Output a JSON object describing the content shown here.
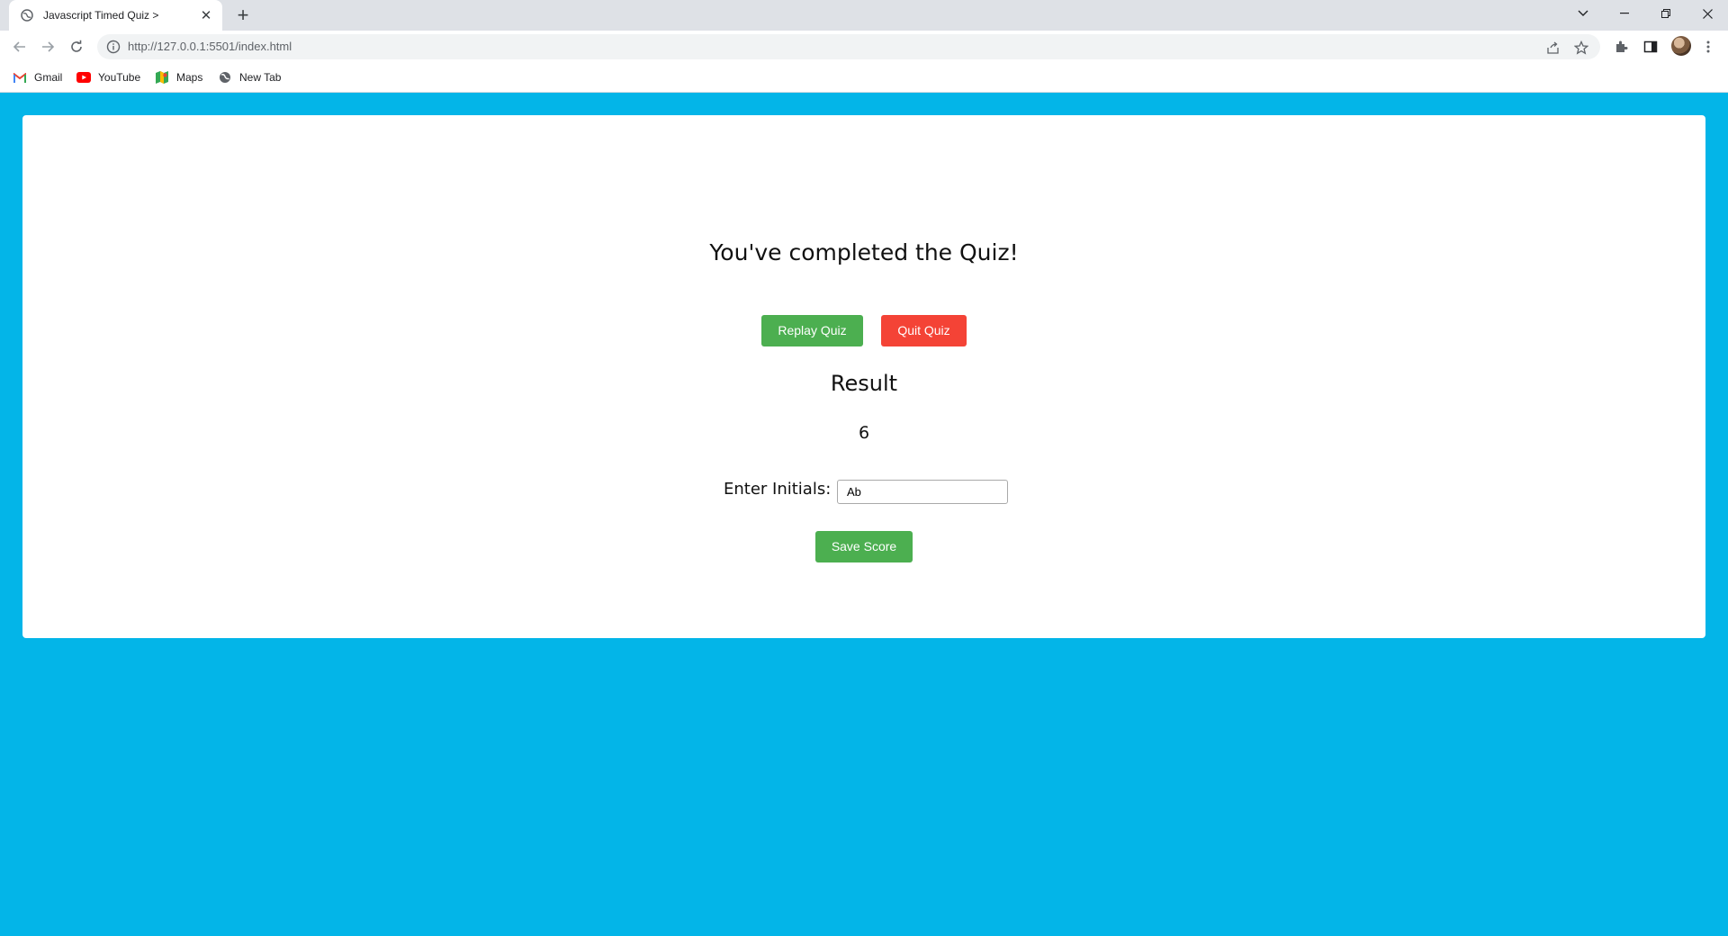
{
  "browser": {
    "tab_title": "Javascript Timed Quiz >",
    "url": "http://127.0.0.1:5501/index.html",
    "bookmarks": [
      {
        "label": "Gmail",
        "icon": "gmail-icon"
      },
      {
        "label": "YouTube",
        "icon": "youtube-icon"
      },
      {
        "label": "Maps",
        "icon": "maps-icon"
      },
      {
        "label": "New Tab",
        "icon": "globe-icon"
      }
    ]
  },
  "quiz": {
    "heading": "You've completed the Quiz!",
    "replay_label": "Replay Quiz",
    "quit_label": "Quit Quiz",
    "result_title": "Result",
    "result_value": "6",
    "initials_label": "Enter Initials:",
    "initials_value": "Ab",
    "save_label": "Save Score"
  },
  "colors": {
    "page_background": "#03b5e8",
    "replay_button": "#4caf50",
    "quit_button": "#f44336",
    "save_button": "#4caf50"
  }
}
